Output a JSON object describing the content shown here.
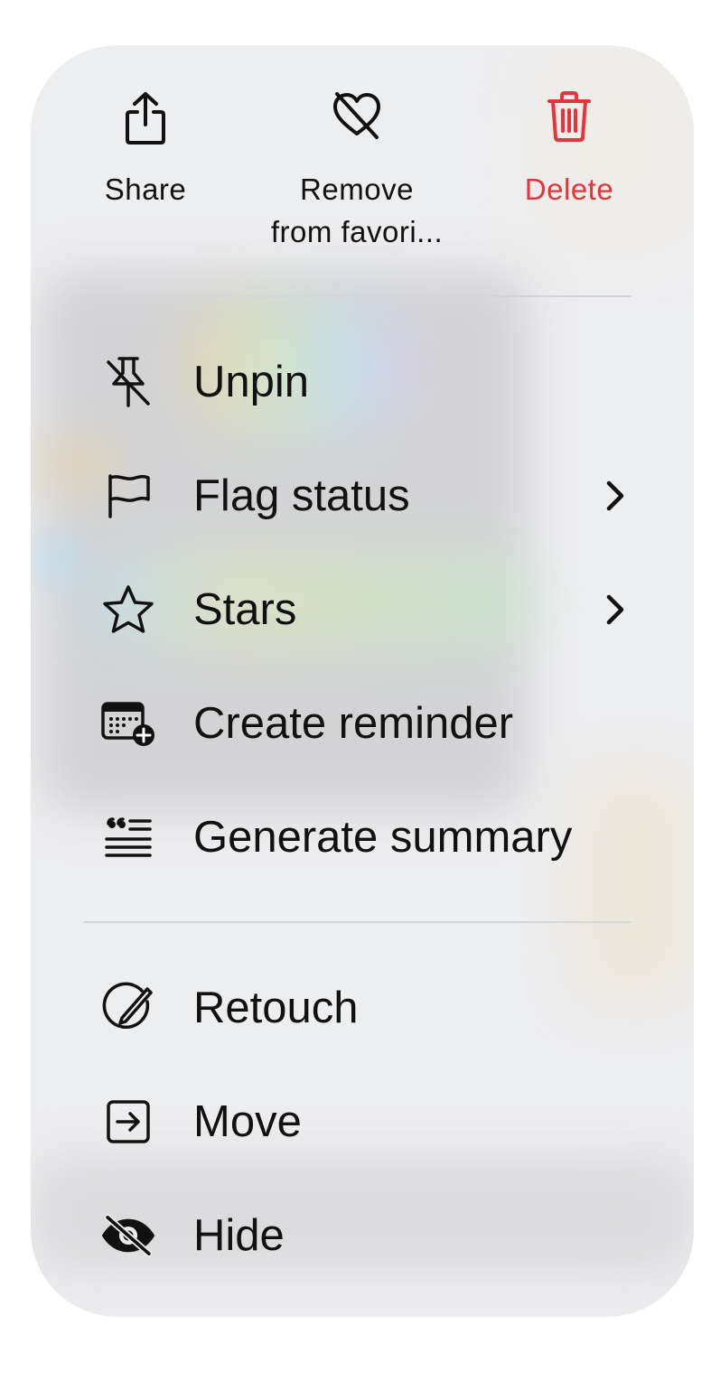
{
  "top_actions": {
    "share": {
      "label": "Share",
      "icon": "share-icon"
    },
    "remove_favorite": {
      "label_line1": "Remove",
      "label_line2": "from favori...",
      "icon": "heart-slash-icon"
    },
    "delete": {
      "label": "Delete",
      "icon": "trash-icon",
      "color": "#e8333a"
    }
  },
  "menu_items": [
    {
      "label": "Unpin",
      "icon": "pin-slash-icon",
      "has_submenu": false
    },
    {
      "label": "Flag status",
      "icon": "flag-icon",
      "has_submenu": true
    },
    {
      "label": "Stars",
      "icon": "star-icon",
      "has_submenu": true
    },
    {
      "label": "Create reminder",
      "icon": "calendar-add-icon",
      "has_submenu": false
    },
    {
      "label": "Generate summary",
      "icon": "quote-summary-icon",
      "has_submenu": false
    }
  ],
  "secondary_items": [
    {
      "label": "Retouch",
      "icon": "retouch-icon"
    },
    {
      "label": "Move",
      "icon": "move-icon"
    },
    {
      "label": "Hide",
      "icon": "eye-slash-icon"
    }
  ]
}
